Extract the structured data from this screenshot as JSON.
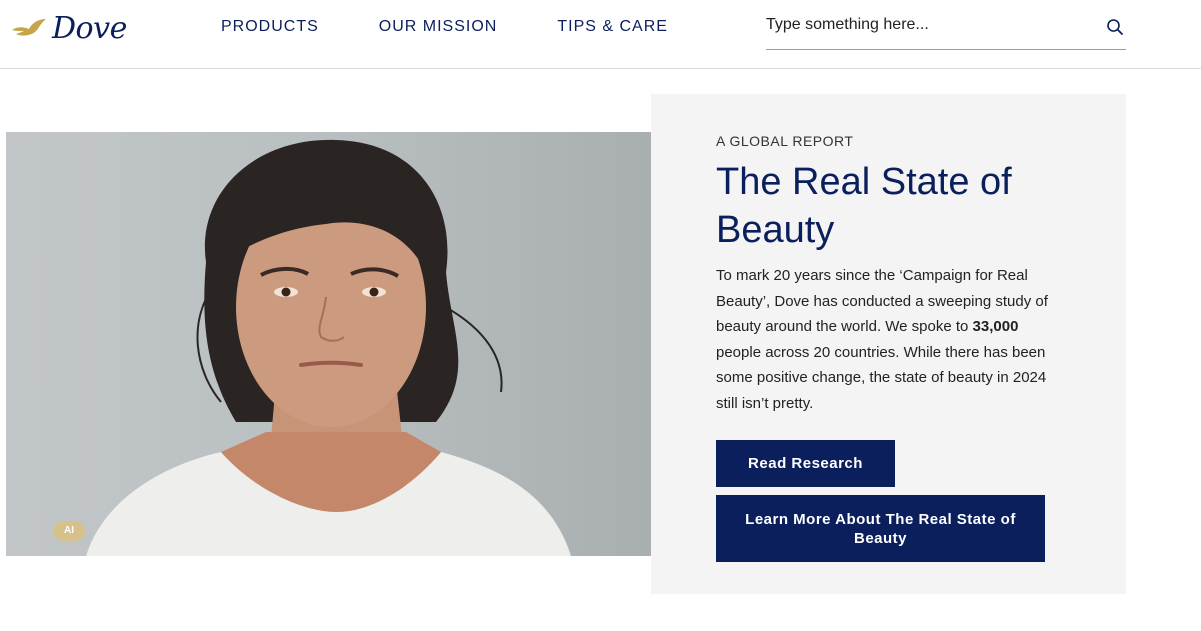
{
  "header": {
    "logo_text": "Dove",
    "nav": [
      "PRODUCTS",
      "OUR MISSION",
      "TIPS & CARE"
    ],
    "search_placeholder": "Type something here..."
  },
  "hero": {
    "ai_badge": "AI"
  },
  "panel": {
    "eyebrow": "A GLOBAL REPORT",
    "title": "The Real State of Beauty",
    "body_part1": "To mark 20 years since the ‘Campaign for Real Beauty’, Dove has conducted a sweeping study of beauty around the world. We spoke to ",
    "body_bold": "33,000",
    "body_part2": " people across 20 countries. While there has been some positive change, the state of beauty in 2024 still isn’t pretty.",
    "read_button": "Read Research",
    "learn_button": "Learn More About The Real State of Beauty"
  },
  "colors": {
    "brand_navy": "#0b1f5c",
    "panel_bg": "#f4f4f4",
    "logo_gold": "#c7a44a"
  },
  "icons": [
    "dove-logo-icon",
    "search-icon"
  ]
}
